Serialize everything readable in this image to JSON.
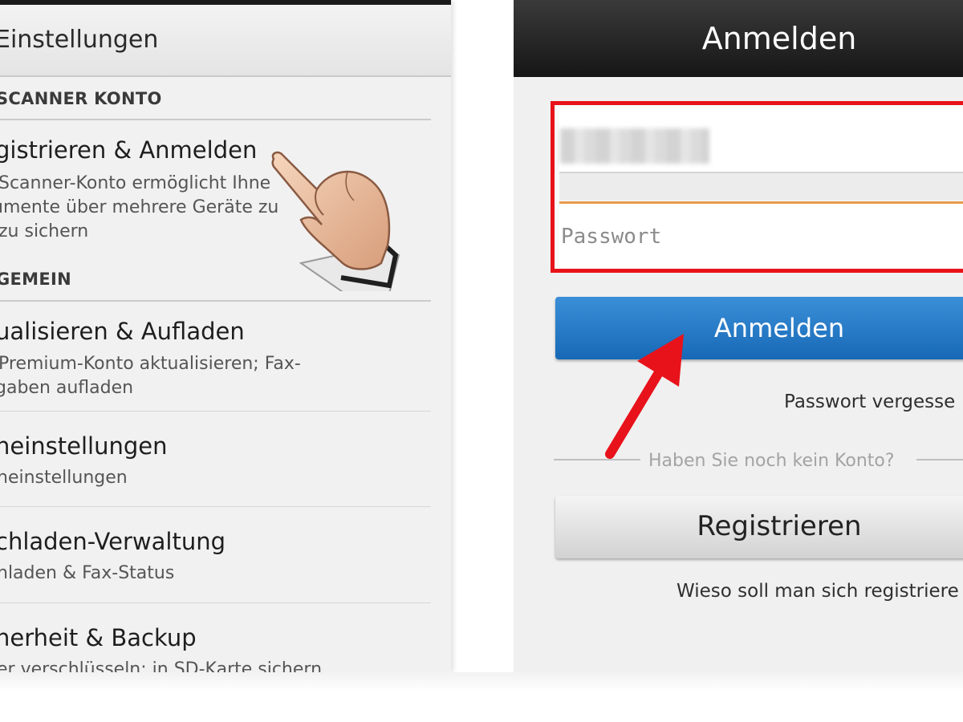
{
  "settings": {
    "title": "Einstellungen",
    "sections": [
      {
        "header": "SCANNER KONTO"
      },
      {
        "header": "GEMEIN"
      }
    ],
    "items": [
      {
        "title": "gistrieren & Anmelden",
        "subtitle_lines": [
          "Scanner-Konto ermöglicht Ihne",
          "umente über mehrere Geräte zu",
          "zu sichern"
        ]
      },
      {
        "title": "ualisieren & Aufladen",
        "subtitle_lines": [
          "Premium-Konto aktualisieren; Fax-",
          "gaben aufladen"
        ]
      },
      {
        "title": "neinstellungen",
        "subtitle_lines": [
          "neinstellungen"
        ]
      },
      {
        "title": "chladen-Verwaltung",
        "subtitle_lines": [
          "hladen & Fax-Status"
        ]
      },
      {
        "title": "herheit & Backup",
        "subtitle_lines": [
          "er verschlüsseln; in SD-Karte sichern"
        ]
      }
    ]
  },
  "login": {
    "title": "Anmelden",
    "password_placeholder": "Passwort",
    "login_button": "Anmelden",
    "forgot_password": "Passwort vergesse",
    "no_account": "Haben Sie noch kein Konto?",
    "register_button": "Registrieren",
    "why_register": "Wieso soll man sich registriere"
  },
  "colors": {
    "highlight_red": "#e8121a",
    "login_blue": "#1f78c8",
    "field_accent": "#e89a4a"
  },
  "icons": {
    "pointer": "hand-pointer-icon",
    "arrow": "red-arrow-icon"
  }
}
